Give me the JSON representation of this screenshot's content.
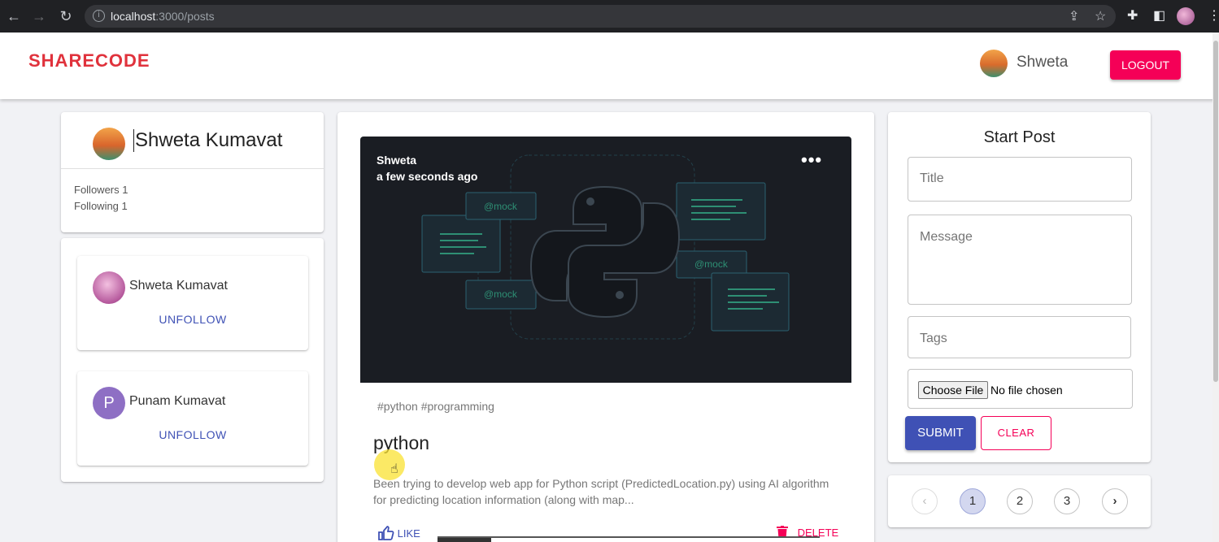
{
  "browser": {
    "url_host": "localhost",
    "url_rest": ":3000/posts"
  },
  "header": {
    "brand": "SHARECODE",
    "username": "Shweta",
    "logout_label": "LOGOUT"
  },
  "profile": {
    "name": "Shweta Kumavat",
    "followers": "Followers 1",
    "following": "Following 1"
  },
  "following_list": [
    {
      "name": "Shweta Kumavat",
      "action": "UNFOLLOW",
      "avatar_letter": ""
    },
    {
      "name": "Punam Kumavat",
      "action": "UNFOLLOW",
      "avatar_letter": "P"
    }
  ],
  "post": {
    "author": "Shweta",
    "time": "a few seconds ago",
    "more": "•••",
    "image_labels": [
      "@mock",
      "@mock",
      "@mock"
    ],
    "tags": "#python #programming",
    "title": "python",
    "message": "Been trying to develop web app for Python script (PredictedLocation.py) using AI algorithm for predicting location information (along with map...",
    "like_label": "LIKE",
    "delete_label": "DELETE"
  },
  "form": {
    "title": "Start Post",
    "title_placeholder": "Title",
    "message_placeholder": "Message",
    "tags_placeholder": "Tags",
    "choose_file": "Choose File",
    "no_file": "No file chosen",
    "submit_label": "SUBMIT",
    "clear_label": "CLEAR"
  },
  "pagination": {
    "prev": "‹",
    "pages": [
      "1",
      "2",
      "3"
    ],
    "next": "›",
    "selected": "1"
  },
  "colors": {
    "brand": "#e0323c",
    "primary": "#3f51b5",
    "secondary": "#f50057"
  }
}
